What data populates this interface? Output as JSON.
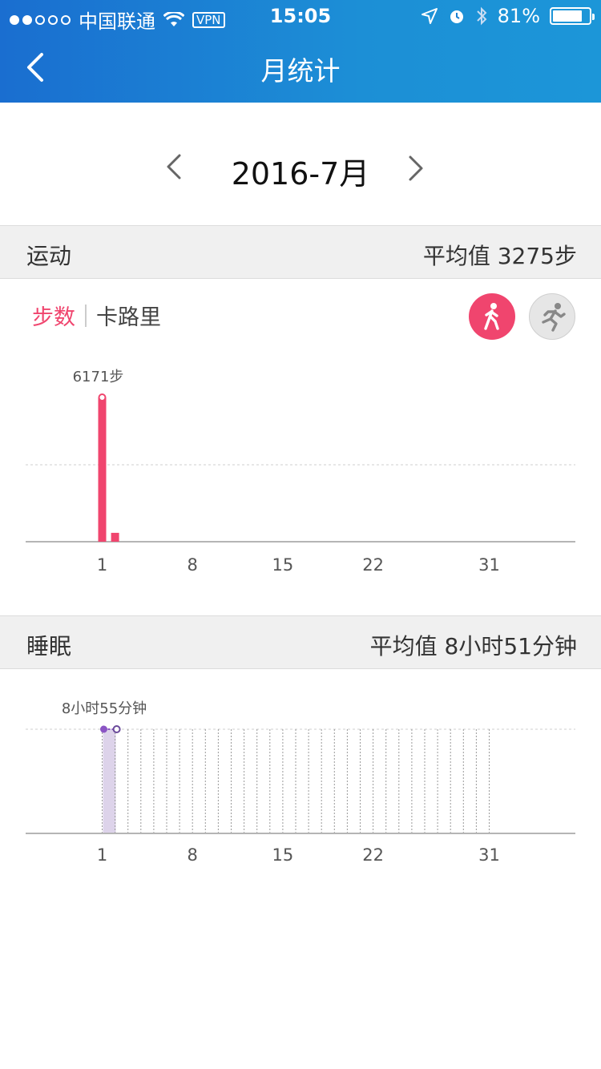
{
  "status_bar": {
    "carrier": "中国联通",
    "vpn": "VPN",
    "time": "15:05",
    "battery": "81%",
    "battery_level": 0.81
  },
  "nav": {
    "title": "月统计",
    "back_icon": "chevron-left-icon"
  },
  "month": {
    "label": "2016-7月",
    "prev_icon": "chevron-left-icon",
    "next_icon": "chevron-right-icon"
  },
  "activity": {
    "section_title": "运动",
    "average_text": "平均值 3275步",
    "tabs": [
      "步数",
      "卡路里"
    ],
    "active_tab": 0,
    "mode_buttons": [
      "walk-icon",
      "run-icon"
    ],
    "accent_color": "#f0456e"
  },
  "sleep": {
    "section_title": "睡眠",
    "average_text": "平均值 8小时51分钟",
    "accent_color": "#8b55c4"
  },
  "chart_data": [
    {
      "type": "bar",
      "x_ticks": [
        "1",
        "8",
        "15",
        "22",
        "31"
      ],
      "days": [
        1,
        2
      ],
      "values": [
        6171,
        380
      ],
      "peak_label": "6171步",
      "color": "#f0456e",
      "grid": "dashed reference line"
    },
    {
      "type": "bar",
      "x_ticks": [
        "1",
        "8",
        "15",
        "22",
        "31"
      ],
      "days": [
        1,
        2
      ],
      "values": [
        535,
        535
      ],
      "peak_label": "8小时55分钟",
      "color": "#8b55c4",
      "grid": "dashed daily lines"
    }
  ]
}
